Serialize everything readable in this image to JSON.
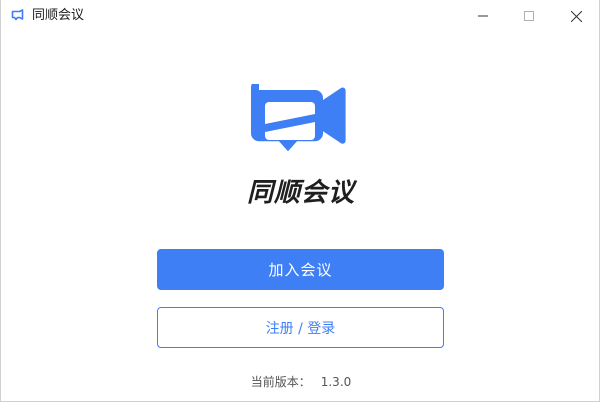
{
  "window": {
    "title": "同顺会议",
    "title_icon": "video-chat-app-icon",
    "controls": {
      "minimize_icon": "minimize-icon",
      "maximize_icon": "maximize-icon",
      "close_icon": "close-icon"
    }
  },
  "brand": {
    "logo_icon": "video-chat-bubble-logo",
    "name": "同顺会议",
    "primary_color": "#3f7ff6"
  },
  "actions": {
    "join_label": "加入会议",
    "login_label": "注册 / 登录"
  },
  "footer": {
    "version_label": "当前版本：",
    "version_value": "1.3.0"
  }
}
